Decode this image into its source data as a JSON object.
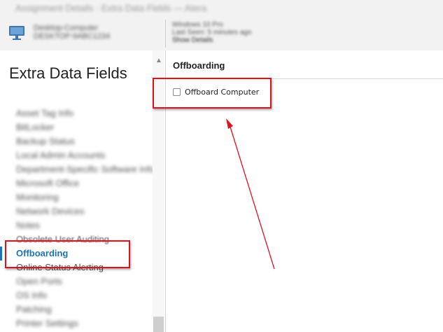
{
  "window": {
    "title": "Assignment Details · Extra Data Fields — Atera"
  },
  "device": {
    "name": "Desktop-Computer",
    "id": "DESKTOP-9ABC1234"
  },
  "header_info": {
    "line1": "Windows 10 Pro",
    "line2": "Last Seen: 5 minutes ago",
    "show_details": "Show Details"
  },
  "page_title": "Extra Data Fields",
  "fields": [
    "Asset Tag Info",
    "BitLocker",
    "Backup Status",
    "Local Admin Accounts",
    "Department-Specific Software Info",
    "Microsoft Office",
    "Monitoring",
    "Network Devices",
    "Notes",
    "Obsolete User Auditing",
    "Offboarding",
    "Online Status Alerting",
    "Open Ports",
    "OS Info",
    "Patching",
    "Printer Settings"
  ],
  "active_field": "Offboarding",
  "section": {
    "title": "Offboarding",
    "checkbox_label": "Offboard Computer",
    "checkbox_checked": false
  },
  "colors": {
    "accent": "#1e73b8",
    "highlight": "#e0101e"
  }
}
